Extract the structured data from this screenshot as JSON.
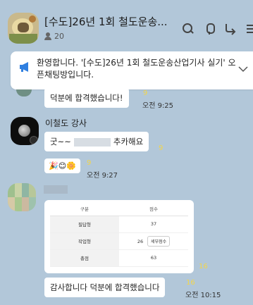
{
  "header": {
    "title": "[수도]26년 1회 철도운송...",
    "member_count": "20"
  },
  "notice": {
    "text": "환영합니다. '[수도]26년 1회 철도운송산업기사 실기' 오픈채팅방입니다."
  },
  "messages": [
    {
      "text": "덕분에 합격했습니다!",
      "unread": "9",
      "time": "오전 9:25"
    },
    {
      "sender": "이철도 강사",
      "text_prefix": "굿~~",
      "text_suffix": "추카해요",
      "unread": "9"
    },
    {
      "emoji": "🎉😊🌼",
      "unread": "9",
      "time": "오전 9:27"
    },
    {
      "unread_card": "16",
      "text": "감사합니다 덕분에 합격했습니다",
      "unread": "16",
      "time": "오전 10:15"
    }
  ],
  "score_table": {
    "headers": [
      "구분",
      "점수"
    ],
    "rows": [
      {
        "label": "필답형",
        "score": "37",
        "button": ""
      },
      {
        "label": "작업형",
        "score": "26",
        "button": "세부점수"
      },
      {
        "label": "총점",
        "score": "63",
        "button": ""
      }
    ]
  },
  "colors": {
    "background": "#b2c7d9",
    "bubble": "#ffffff",
    "unread": "#f2d54b",
    "notice_icon": "#2f7fe0"
  }
}
